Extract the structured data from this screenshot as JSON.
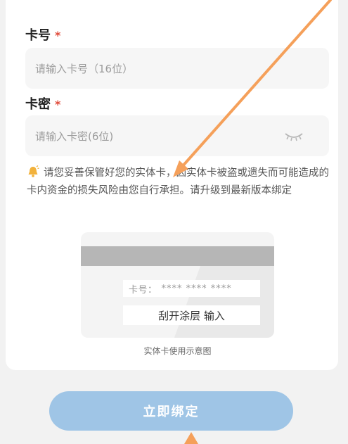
{
  "card_number": {
    "label": "卡号",
    "required_mark": "*",
    "placeholder": "请输入卡号（16位）"
  },
  "card_password": {
    "label": "卡密",
    "required_mark": "*",
    "placeholder": "请输入卡密(6位)",
    "toggle_icon": "eye-closed-icon"
  },
  "notice": {
    "icon": "bell-icon",
    "text": "请您妥善保管好您的实体卡，因实体卡被盗或遗失而可能造成的卡内资金的损失风险由您自行承担。请升级到最新版本绑定"
  },
  "illustration": {
    "card_number_label": "卡号：",
    "card_number_mask": "**** **** ****",
    "scratch_text": "刮开涂层 输入",
    "caption": "实体卡使用示意图"
  },
  "bind_button": {
    "label": "立即绑定"
  },
  "colors": {
    "accent_button": "#9fc5e6",
    "required": "#e04a3a",
    "annotation_arrow": "#f5a05a"
  }
}
